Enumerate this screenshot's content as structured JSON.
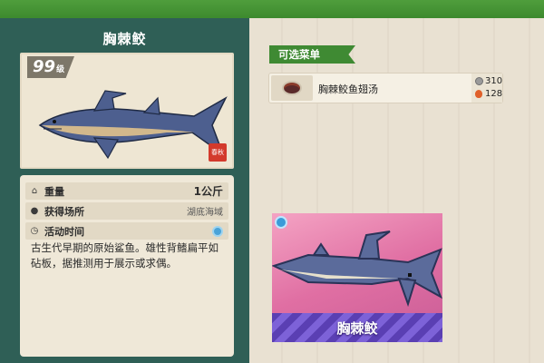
{
  "fish": {
    "name": "胸棘鲛",
    "level": "99",
    "level_unit": "级",
    "seal_text": "春秋"
  },
  "info": {
    "weight_label": "重量",
    "weight_value": "1公斤",
    "location_label": "获得场所",
    "location_value": "湖底海域",
    "time_label": "活动时间",
    "description": "古生代早期的原始鲨鱼。雄性背鳍扁平如砧板，据推测用于展示或求偶。"
  },
  "menu": {
    "header": "可选菜单",
    "recipes": [
      {
        "name": "胸棘鲛鱼翅汤",
        "price": "310",
        "taste": "128"
      }
    ]
  },
  "preview": {
    "name": "胸棘鲛"
  },
  "icons": {
    "weight": "scale-icon",
    "location": "pin-icon",
    "time": "clock-icon",
    "weather": "sun-icon",
    "price": "coin-icon",
    "taste": "flame-icon"
  },
  "colors": {
    "panel": "#2f5f56",
    "accent_green": "#3f8a33",
    "band": "#5a3fb3"
  }
}
